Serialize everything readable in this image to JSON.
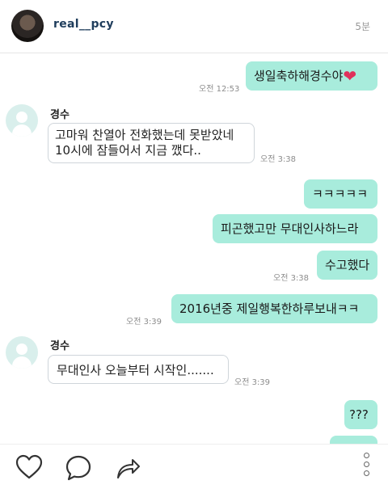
{
  "header": {
    "username": "real__pcy",
    "time_ago": "5분"
  },
  "peer": {
    "name": "경수"
  },
  "messages": [
    {
      "side": "out",
      "text": "생일축하해경수야",
      "has_heart": true,
      "time": "오전 12:53"
    },
    {
      "side": "in",
      "lines": [
        "고마워 찬열아 전화했는데 못받았네",
        "10시에 잠들어서 지금 깼다.."
      ],
      "time": "오전 3:38"
    },
    {
      "side": "out",
      "text": "ㅋㅋㅋㅋㅋ"
    },
    {
      "side": "out",
      "text": "피곤했고만 무대인사하느라"
    },
    {
      "side": "out",
      "text": "수고했다",
      "time": "오전 3:38"
    },
    {
      "side": "out",
      "text": "2016년중 제일행복한하루보내ㅋㅋ",
      "time": "오전 3:39"
    },
    {
      "side": "in",
      "text": "무대인사 오늘부터 시작인.......",
      "time": "오전 3:39"
    },
    {
      "side": "out",
      "text": "???"
    }
  ],
  "actions": [
    "heart-icon",
    "comment-icon",
    "share-icon",
    "more-icon"
  ]
}
